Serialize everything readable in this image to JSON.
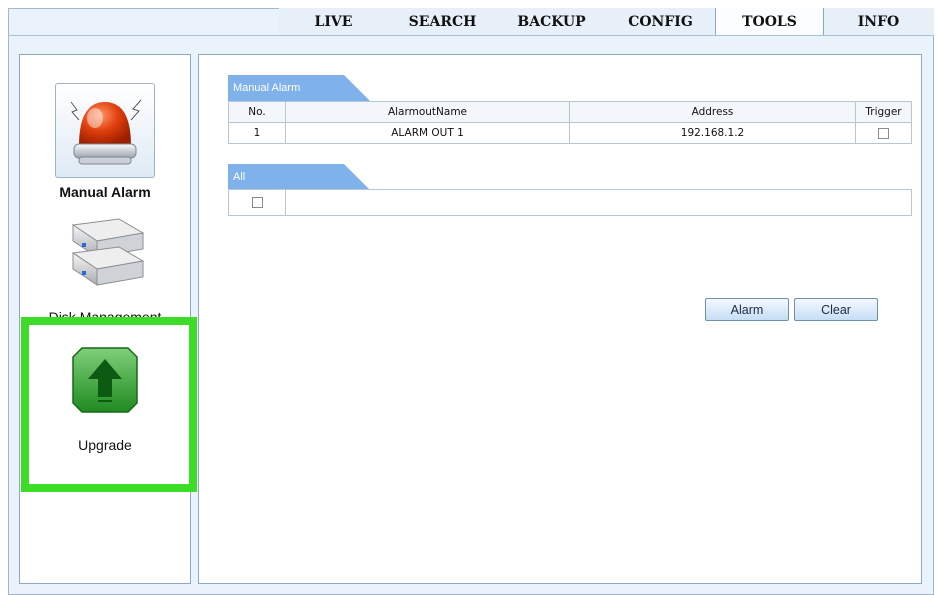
{
  "nav": {
    "tabs": [
      {
        "label": "LIVE"
      },
      {
        "label": "SEARCH"
      },
      {
        "label": "BACKUP"
      },
      {
        "label": "CONFIG"
      },
      {
        "label": "TOOLS"
      },
      {
        "label": "INFO"
      }
    ],
    "active_index": 4
  },
  "sidebar": {
    "items": [
      {
        "label": "Manual Alarm",
        "icon": "alarm-siren-icon",
        "selected": true
      },
      {
        "label": "Disk Management",
        "icon": "hard-disk-icon"
      },
      {
        "label": "Upgrade",
        "icon": "upgrade-arrow-icon"
      }
    ]
  },
  "manual_alarm": {
    "section_title": "Manual Alarm",
    "columns": [
      "No.",
      "AlarmoutName",
      "Address",
      "Trigger"
    ],
    "rows": [
      {
        "no": "1",
        "name": "ALARM OUT 1",
        "address": "192.168.1.2",
        "trigger": false
      }
    ]
  },
  "all_section": {
    "section_title": "All",
    "checked": false
  },
  "buttons": {
    "alarm": "Alarm",
    "clear": "Clear"
  },
  "colors": {
    "highlight": "#3ddc28",
    "section_header": "#7fb2ea",
    "background": "#eaf3fb"
  }
}
